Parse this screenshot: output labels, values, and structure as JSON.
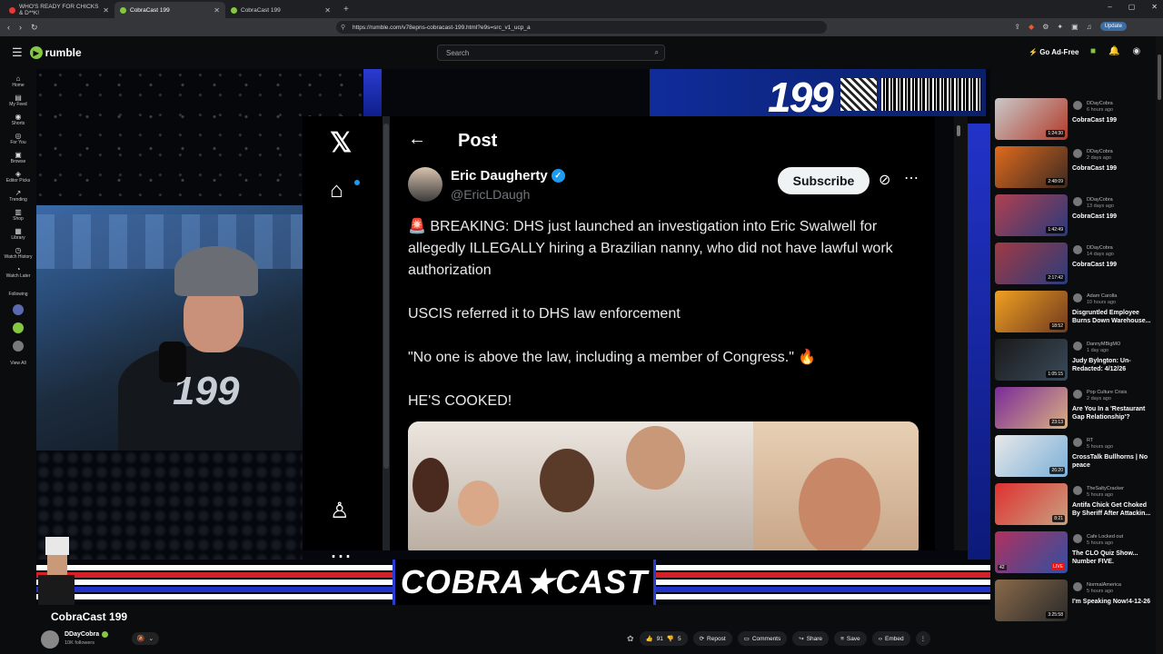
{
  "browser": {
    "tabs": [
      {
        "title": "WHO'S READY FOR CHICKS & D**K!",
        "active": false,
        "favicon_color": "#e53935"
      },
      {
        "title": "CobraCast 199",
        "active": true,
        "favicon_color": "#85c742"
      },
      {
        "title": "CobraCast 199",
        "active": false,
        "favicon_color": "#85c742"
      }
    ],
    "url": "https://rumble.com/v78epns-cobracast-199.html?e9s=src_v1_ucp_a",
    "update_label": "Update"
  },
  "header": {
    "logo_text": "rumble",
    "search_placeholder": "Search",
    "go_ad_free": "Go Ad-Free"
  },
  "sidebar": {
    "items": [
      {
        "label": "Home",
        "icon": "home-icon",
        "glyph": "⌂"
      },
      {
        "label": "My Feed",
        "icon": "feed-icon",
        "glyph": "▤"
      },
      {
        "label": "Shorts",
        "icon": "shorts-icon",
        "glyph": "◉"
      },
      {
        "label": "For You",
        "icon": "for-you-icon",
        "glyph": "◎"
      },
      {
        "label": "Browse",
        "icon": "browse-icon",
        "glyph": "▣"
      },
      {
        "label": "Editor Picks",
        "icon": "editor-picks-icon",
        "glyph": "◈"
      },
      {
        "label": "Trending",
        "icon": "trending-icon",
        "glyph": "↗"
      },
      {
        "label": "Shop",
        "icon": "shop-icon",
        "glyph": "▥"
      },
      {
        "label": "Library",
        "icon": "library-icon",
        "glyph": "▦"
      },
      {
        "label": "Watch History",
        "icon": "history-icon",
        "glyph": "◷"
      },
      {
        "label": "Watch Later",
        "icon": "watch-later-icon",
        "glyph": "◔"
      }
    ],
    "following_label": "Following",
    "view_all": "View All"
  },
  "video": {
    "banner_number": "199",
    "banner_text": "COBRA★CAST",
    "jersey_number": "199",
    "tweet": {
      "header": "Post",
      "author_name": "Eric Daugherty",
      "author_handle": "@EricLDaugh",
      "subscribe": "Subscribe",
      "paragraphs": [
        "🚨 BREAKING: DHS just launched an investigation into Eric Swalwell for allegedly ILLEGALLY hiring a Brazilian nanny, who did not have lawful work authorization",
        "USCIS referred it to DHS law enforcement",
        "\"No one is above the law, including a member of Congress.\" 🔥",
        "HE'S COOKED!"
      ]
    }
  },
  "below": {
    "title": "CobraCast 199",
    "channel": "DDayCobra",
    "followers": "10K followers",
    "likes": "91",
    "dislikes": "5",
    "actions": [
      "Repost",
      "Comments",
      "Share",
      "Save",
      "Embed"
    ]
  },
  "recommendations": [
    {
      "channel": "DDayCobra",
      "time": "6 hours ago",
      "title": "CobraCast 199",
      "duration": "1:24:30",
      "thumb": [
        "#c9c9c9",
        "#b23a2a"
      ]
    },
    {
      "channel": "DDayCobra",
      "time": "2 days ago",
      "title": "CobraCast 199",
      "duration": "2:48:09",
      "thumb": [
        "#e06a1c",
        "#3b2a22"
      ]
    },
    {
      "channel": "DDayCobra",
      "time": "13 days ago",
      "title": "CobraCast 199",
      "duration": "1:42:49",
      "thumb": [
        "#b04050",
        "#2a3a7a"
      ]
    },
    {
      "channel": "DDayCobra",
      "time": "14 days ago",
      "title": "CobraCast 199",
      "duration": "2:17:42",
      "thumb": [
        "#a03a44",
        "#2a3c7c"
      ]
    },
    {
      "channel": "Adam Carolla",
      "time": "10 hours ago",
      "title": "Disgruntled Employee Burns Down Warehouse...",
      "duration": "18:52",
      "thumb": [
        "#f0a020",
        "#703a20"
      ]
    },
    {
      "channel": "DannyMBigMO",
      "time": "1 day ago",
      "title": "Judy Bylngton: Un-Redacted: 4/12/26",
      "duration": "1:05:15",
      "thumb": [
        "#1a1a1a",
        "#3a4a5a"
      ]
    },
    {
      "channel": "Pop Culture Crisis",
      "time": "2 days ago",
      "title": "Are You In a 'Restaurant Gap Relationship'?",
      "duration": "23:13",
      "thumb": [
        "#7a2a9a",
        "#d8b080"
      ]
    },
    {
      "channel": "RT",
      "time": "5 hours ago",
      "title": "CrossTalk Bullhorns | No peace",
      "duration": "26:20",
      "thumb": [
        "#e8e8e8",
        "#7ab0d8"
      ]
    },
    {
      "channel": "TheSaltyCracker",
      "time": "5 hours ago",
      "title": "Antifa Chick Get Choked By Sheriff After Attackin...",
      "duration": "8:21",
      "thumb": [
        "#e03030",
        "#c8a080"
      ]
    },
    {
      "channel": "Cafe Locked out",
      "time": "5 hours ago",
      "title": "The CLO Quiz Show... Number FIVE.",
      "duration": "",
      "live": "LIVE",
      "views": "42",
      "thumb": [
        "#b03060",
        "#3050a0"
      ]
    },
    {
      "channel": "NormalAmerica",
      "time": "5 hours ago",
      "title": "I'm Speaking Now!4-12-26",
      "duration": "3:25:58",
      "thumb": [
        "#8a6a4a",
        "#2a2a2a"
      ]
    }
  ],
  "colors": {
    "accent": "#85c742",
    "x_blue": "#1d9bf0"
  }
}
